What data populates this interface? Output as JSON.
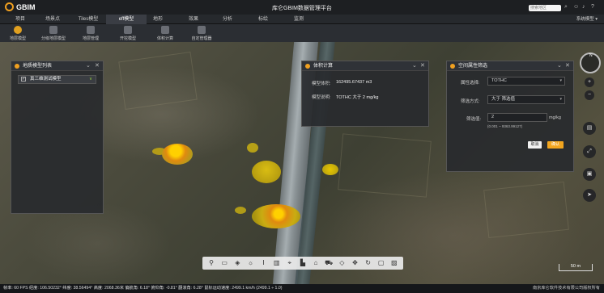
{
  "header": {
    "logo_text": "GBIM",
    "title": "库仑GBIM数据管理平台",
    "search_placeholder": "搜索地区",
    "icons": [
      "search-icon",
      "user-icon",
      "bell-icon",
      "help-icon"
    ]
  },
  "menu": {
    "items": [
      "项目",
      "场景点",
      "Tiles模型",
      "eff模型",
      "地形",
      "效果",
      "分析",
      "标绘",
      "监测"
    ],
    "active": "eff模型",
    "system_settings": "系统模型"
  },
  "toolbar": {
    "tools": [
      {
        "label": "地层模型",
        "icon": "layer-model-icon"
      },
      {
        "label": "分级地层模型",
        "icon": "grading-model-icon"
      },
      {
        "label": "地层管理",
        "icon": "layer-manage-icon"
      },
      {
        "label": "开挖模型",
        "icon": "excavate-icon"
      },
      {
        "label": "体积计算",
        "icon": "volume-icon"
      },
      {
        "label": "自定管理器",
        "icon": "custom-manager-icon"
      }
    ]
  },
  "layer_panel": {
    "title": "地质模型列表",
    "items": [
      {
        "label": "真三维测试模型",
        "checked": true
      }
    ]
  },
  "volume_panel": {
    "title": "体积计算",
    "volume_label": "模型体积:",
    "volume_value": "162495.67437 m3",
    "desc_label": "模型说明:",
    "desc_value": "TOTHC 大于 2 mg/kg"
  },
  "filter_panel": {
    "title": "空间属性筛选",
    "attr_label": "属性选择:",
    "attr_value": "TOTHC",
    "method_label": "筛选方式:",
    "method_value": "大于 筛选值",
    "threshold_label": "筛选值:",
    "threshold_value": "2",
    "threshold_unit": "mg/kg",
    "range_hint": "(0.001 ~ 9363.99127)",
    "cancel_label": "取消",
    "confirm_label": "确认"
  },
  "map": {
    "scale_label": "50 m"
  },
  "right_tools": [
    "zoom-in-icon",
    "zoom-out-icon",
    "layers-icon",
    "fullscreen-icon",
    "screenshot-icon",
    "navigate-icon"
  ],
  "bottom_tools": [
    "marker-icon",
    "monitor-icon",
    "layers-stack-icon",
    "sun-icon",
    "text-icon",
    "book-icon",
    "pin-icon",
    "chart-icon",
    "bank-icon",
    "car-icon",
    "cube-icon",
    "move-icon",
    "rotate-icon",
    "box-icon",
    "image-icon"
  ],
  "status": {
    "text": "帧率: 60 FPS  经度: 106.50232°  纬度: 38.56494°  高度: 2068.36米  偏航角: 6.18°  俯仰角: -0.81°  翻滚角: 6.28°  鼠标运动速度: 2499.1 km/h (2499.1 ÷ 1.0)",
    "copyright": "南京库仑软件技术有限公司版权所有"
  }
}
